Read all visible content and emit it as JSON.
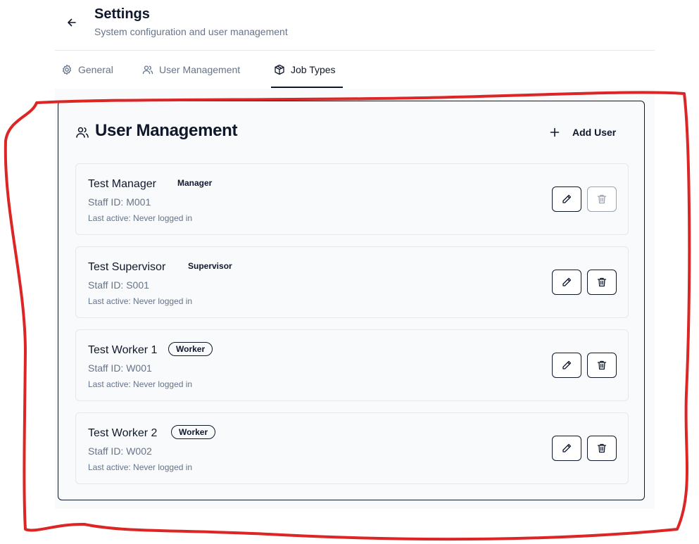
{
  "header": {
    "title": "Settings",
    "subtitle": "System configuration and user management"
  },
  "tabs": [
    {
      "label": "General",
      "icon": "gear-icon"
    },
    {
      "label": "User Management",
      "icon": "users-icon"
    },
    {
      "label": "Job Types",
      "icon": "package-icon",
      "active": true
    }
  ],
  "panel": {
    "title": "User Management",
    "add_button": "Add User"
  },
  "users": [
    {
      "name": "Test Manager",
      "role": "Manager",
      "staff_id": "Staff ID: M001",
      "last_active": "Last active: Never logged in",
      "delete_disabled": true
    },
    {
      "name": "Test Supervisor",
      "role": "Supervisor",
      "staff_id": "Staff ID: S001",
      "last_active": "Last active: Never logged in"
    },
    {
      "name": "Test Worker 1",
      "role": "Worker",
      "staff_id": "Staff ID: W001",
      "last_active": "Last active: Never logged in"
    },
    {
      "name": "Test Worker 2",
      "role": "Worker",
      "staff_id": "Staff ID: W002",
      "last_active": "Last active: Never logged in"
    }
  ],
  "colors": {
    "text": "#0f172a",
    "muted": "#64748b",
    "annotation": "#dc2626"
  }
}
